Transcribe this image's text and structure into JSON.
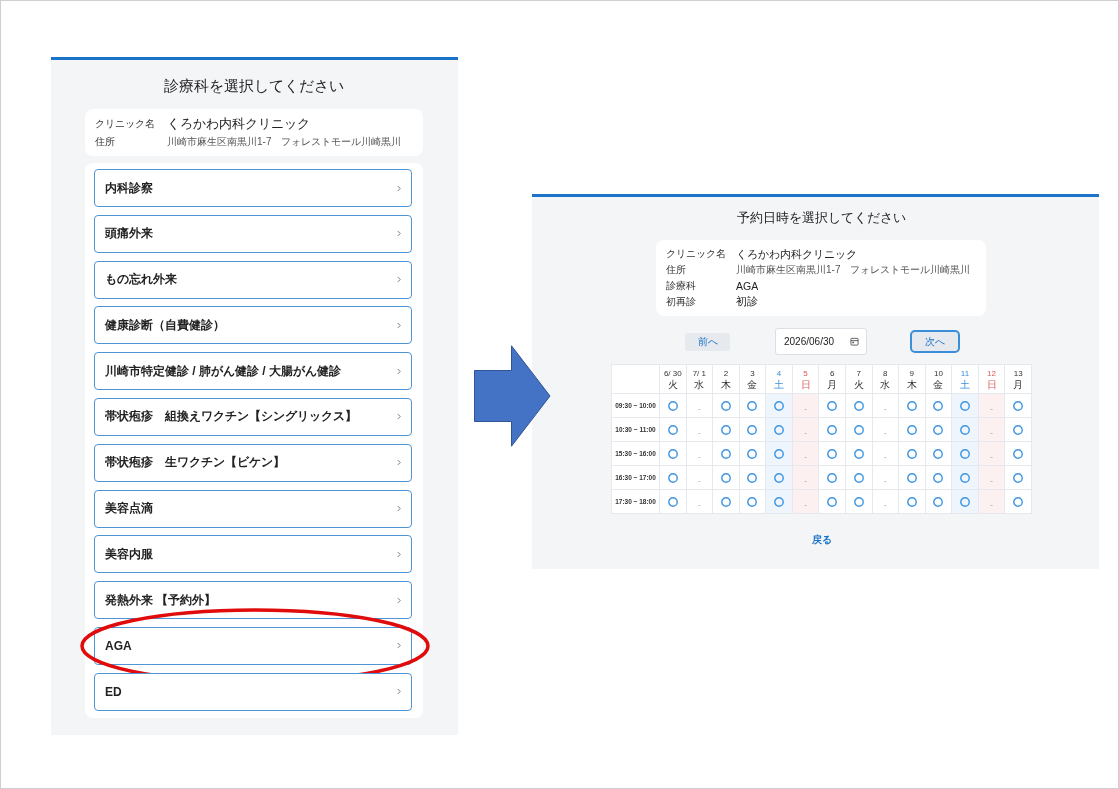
{
  "department_screen": {
    "title": "診療科を選択してください",
    "clinic": [
      {
        "label": "クリニック名",
        "value": "くろかわ内科クリニック",
        "kind": "name"
      },
      {
        "label": "住所",
        "value": "川崎市麻生区南黒川1-7　フォレストモール川崎黒川",
        "kind": "address"
      }
    ],
    "departments": [
      {
        "label": "内科診察",
        "highlighted": false
      },
      {
        "label": "頭痛外来",
        "highlighted": false
      },
      {
        "label": "もの忘れ外来",
        "highlighted": false
      },
      {
        "label": "健康診断（自費健診）",
        "highlighted": false
      },
      {
        "label": "川崎市特定健診 / 肺がん健診 / 大腸がん健診",
        "highlighted": false
      },
      {
        "label": "帯状疱疹　組換えワクチン【シングリックス】",
        "highlighted": false
      },
      {
        "label": "帯状疱疹　生ワクチン【ビケン】",
        "highlighted": false
      },
      {
        "label": "美容点滴",
        "highlighted": false
      },
      {
        "label": "美容内服",
        "highlighted": false
      },
      {
        "label": "発熱外来 【予約外】",
        "highlighted": false
      },
      {
        "label": "AGA",
        "highlighted": true
      },
      {
        "label": "ED",
        "highlighted": false
      }
    ]
  },
  "schedule_screen": {
    "title": "予約日時を選択してください",
    "info": [
      {
        "label": "クリニック名",
        "value": "くろかわ内科クリニック",
        "kind": "name"
      },
      {
        "label": "住所",
        "value": "川崎市麻生区南黒川1-7　フォレストモール川崎黒川",
        "kind": "address"
      },
      {
        "label": "診療科",
        "value": "AGA",
        "kind": "text"
      },
      {
        "label": "初再診",
        "value": "初診",
        "kind": "text"
      }
    ],
    "prev_button": {
      "label": "前へ",
      "focused": false
    },
    "date_field": {
      "value": "2026/06/30"
    },
    "next_button": {
      "label": "次へ",
      "focused": true
    },
    "calendar": {
      "columns": [
        {
          "date": "6/ 30",
          "weekday": "火",
          "kind": "weekday"
        },
        {
          "date": "7/ 1",
          "weekday": "水",
          "kind": "weekday"
        },
        {
          "date": "2",
          "weekday": "木",
          "kind": "weekday"
        },
        {
          "date": "3",
          "weekday": "金",
          "kind": "weekday"
        },
        {
          "date": "4",
          "weekday": "土",
          "kind": "saturday"
        },
        {
          "date": "5",
          "weekday": "日",
          "kind": "sunday"
        },
        {
          "date": "6",
          "weekday": "月",
          "kind": "weekday"
        },
        {
          "date": "7",
          "weekday": "火",
          "kind": "weekday"
        },
        {
          "date": "8",
          "weekday": "水",
          "kind": "weekday"
        },
        {
          "date": "9",
          "weekday": "木",
          "kind": "weekday"
        },
        {
          "date": "10",
          "weekday": "金",
          "kind": "weekday"
        },
        {
          "date": "11",
          "weekday": "土",
          "kind": "saturday"
        },
        {
          "date": "12",
          "weekday": "日",
          "kind": "sunday"
        },
        {
          "date": "13",
          "weekday": "月",
          "kind": "weekday"
        }
      ],
      "rows": [
        {
          "time": "09:30 ~ 10:00",
          "slots": [
            {
              "available": true
            },
            {
              "available": false,
              "label": "-"
            },
            {
              "available": true
            },
            {
              "available": true
            },
            {
              "available": true
            },
            {
              "available": false,
              "label": "-"
            },
            {
              "available": true
            },
            {
              "available": true
            },
            {
              "available": false,
              "label": "-"
            },
            {
              "available": true
            },
            {
              "available": true
            },
            {
              "available": true
            },
            {
              "available": false,
              "label": "-"
            },
            {
              "available": true
            }
          ]
        },
        {
          "time": "10:30 ~ 11:00",
          "slots": [
            {
              "available": true
            },
            {
              "available": false,
              "label": "-"
            },
            {
              "available": true
            },
            {
              "available": true
            },
            {
              "available": true
            },
            {
              "available": false,
              "label": "-"
            },
            {
              "available": true
            },
            {
              "available": true
            },
            {
              "available": false,
              "label": "-"
            },
            {
              "available": true
            },
            {
              "available": true
            },
            {
              "available": true
            },
            {
              "available": false,
              "label": "-"
            },
            {
              "available": true
            }
          ]
        },
        {
          "time": "15:30 ~ 16:00",
          "slots": [
            {
              "available": true
            },
            {
              "available": false,
              "label": "-"
            },
            {
              "available": true
            },
            {
              "available": true
            },
            {
              "available": true
            },
            {
              "available": false,
              "label": "-"
            },
            {
              "available": true
            },
            {
              "available": true
            },
            {
              "available": false,
              "label": "-"
            },
            {
              "available": true
            },
            {
              "available": true
            },
            {
              "available": true
            },
            {
              "available": false,
              "label": "-"
            },
            {
              "available": true
            }
          ]
        },
        {
          "time": "16:30 ~ 17:00",
          "slots": [
            {
              "available": true
            },
            {
              "available": false,
              "label": "-"
            },
            {
              "available": true
            },
            {
              "available": true
            },
            {
              "available": true
            },
            {
              "available": false,
              "label": "-"
            },
            {
              "available": true
            },
            {
              "available": true
            },
            {
              "available": false,
              "label": "-"
            },
            {
              "available": true
            },
            {
              "available": true
            },
            {
              "available": true
            },
            {
              "available": false,
              "label": "-"
            },
            {
              "available": true
            }
          ]
        },
        {
          "time": "17:30 ~ 18:00",
          "slots": [
            {
              "available": true
            },
            {
              "available": false,
              "label": "-"
            },
            {
              "available": true
            },
            {
              "available": true
            },
            {
              "available": true
            },
            {
              "available": false,
              "label": "-"
            },
            {
              "available": true
            },
            {
              "available": true
            },
            {
              "available": false,
              "label": "-"
            },
            {
              "available": true
            },
            {
              "available": true
            },
            {
              "available": true
            },
            {
              "available": false,
              "label": "-"
            },
            {
              "available": true
            }
          ]
        }
      ]
    },
    "back_link": "戻る"
  }
}
